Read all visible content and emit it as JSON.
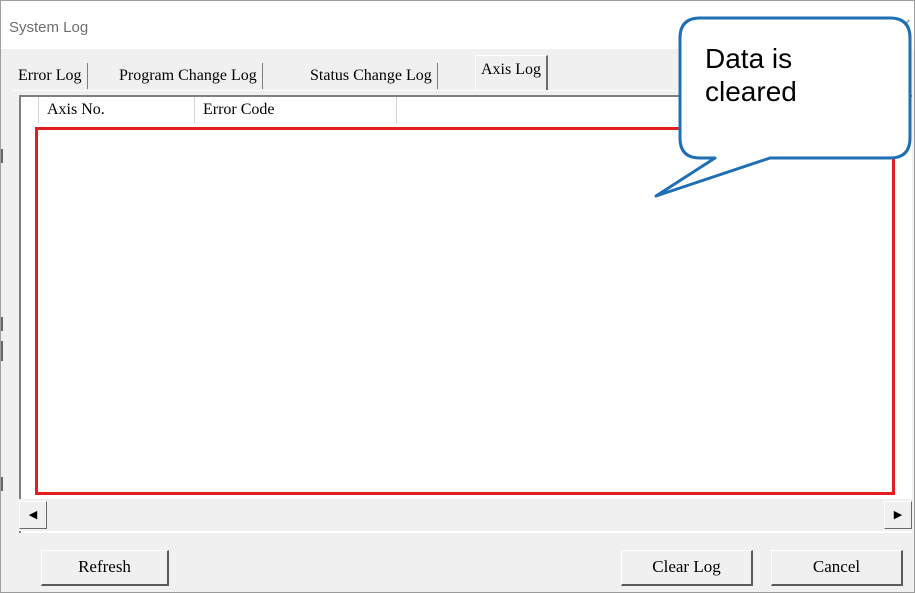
{
  "window": {
    "title": "System Log",
    "close_glyph": "✕"
  },
  "tabs": [
    {
      "label": "Error Log",
      "active": false
    },
    {
      "label": "Program Change Log",
      "active": false
    },
    {
      "label": "Status Change Log",
      "active": false
    },
    {
      "label": "Axis Log",
      "active": true
    }
  ],
  "list": {
    "columns": [
      "Axis No.",
      "Error Code"
    ],
    "rows": []
  },
  "scrollbar": {
    "left_arrow": "◀",
    "right_arrow": "▶"
  },
  "buttons": {
    "refresh": "Refresh",
    "clear_log": "Clear Log",
    "cancel": "Cancel"
  },
  "callout": {
    "line1": "Data is",
    "line2": "cleared"
  },
  "colors": {
    "highlight_border": "#e41e1e",
    "callout_stroke": "#1f6fb5"
  }
}
